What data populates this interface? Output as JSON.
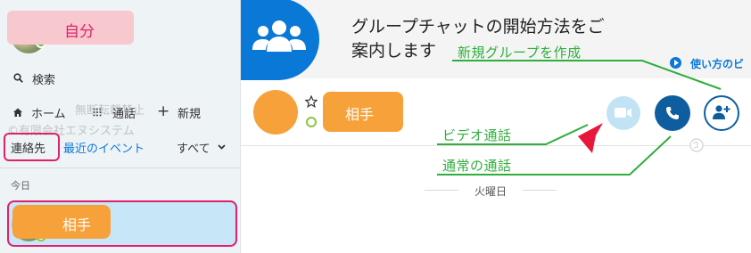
{
  "profile": {
    "self_label": "自分"
  },
  "sidebar": {
    "search_label": "検索",
    "nav": [
      {
        "label": "ホーム"
      },
      {
        "label": "通話"
      },
      {
        "label": "新規"
      }
    ],
    "tabs": [
      {
        "label": "連絡先"
      },
      {
        "label": "最近のイベント"
      }
    ],
    "filter_label": "すべて",
    "section_today": "今日",
    "contact_label": "相手",
    "watermark_line1": "無断転載禁止",
    "watermark_line2": "©有限会社エヌシステム"
  },
  "banner": {
    "line1": "グループチャットの開始方法をご",
    "line2": "案内します",
    "how_to_link": "使い方のビ"
  },
  "chat_header": {
    "contact_label": "相手"
  },
  "annotations": {
    "new_group": "新規グループを作成",
    "video_call": "ビデオ通話",
    "audio_call": "通常の通話"
  },
  "conversation": {
    "date_divider": "火曜日"
  },
  "colors": {
    "accent": "#0a78d7",
    "call_blue": "#0e5e9f",
    "annotation_green": "#2fae3c",
    "highlight_pink": "#e0206c",
    "label_orange": "#f7a13a"
  }
}
